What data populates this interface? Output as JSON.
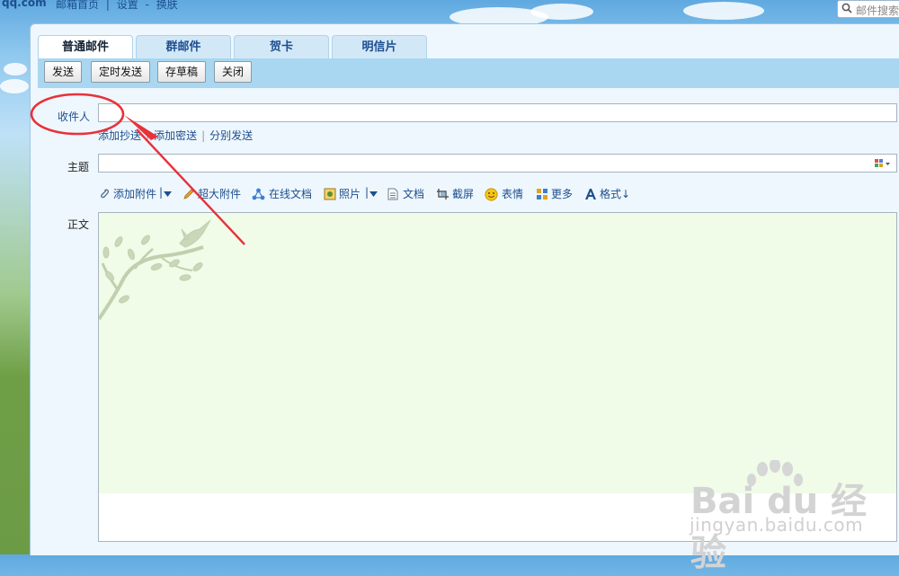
{
  "header": {
    "logo": "qq.com",
    "links": [
      "邮箱首页",
      "|",
      "设置",
      "-",
      "换肤"
    ],
    "search_placeholder": "邮件搜索"
  },
  "tabs": [
    {
      "label": "普通邮件",
      "active": true
    },
    {
      "label": "群邮件",
      "active": false
    },
    {
      "label": "贺卡",
      "active": false
    },
    {
      "label": "明信片",
      "active": false
    }
  ],
  "toolbar": {
    "send": "发送",
    "scheduled_send": "定时发送",
    "save_draft": "存草稿",
    "close": "关闭"
  },
  "form": {
    "to_label": "收件人",
    "to_value": "",
    "add_cc": "添加抄送",
    "add_bcc": "添加密送",
    "separate_send": "分别发送",
    "subject_label": "主题",
    "subject_value": "",
    "body_label": "正文"
  },
  "attachments": [
    {
      "label": "添加附件",
      "icon": "paperclip-icon"
    },
    {
      "label": "超大附件",
      "icon": "pencil-icon"
    },
    {
      "label": "在线文档",
      "icon": "share-icon"
    },
    {
      "label": "照片",
      "icon": "photo-icon"
    },
    {
      "label": "文档",
      "icon": "document-icon"
    },
    {
      "label": "截屏",
      "icon": "screenshot-icon"
    },
    {
      "label": "表情",
      "icon": "smiley-icon"
    },
    {
      "label": "更多",
      "icon": "grid-icon"
    },
    {
      "label": "格式↓",
      "icon": "format-a-icon"
    }
  ],
  "watermark": {
    "brand": "Bai du 经验",
    "url": "jingyan.baidu.com"
  },
  "colors": {
    "link": "#1d4e8f",
    "annotation_red": "#e8323a",
    "toolstrip": "#a9d6f0"
  }
}
